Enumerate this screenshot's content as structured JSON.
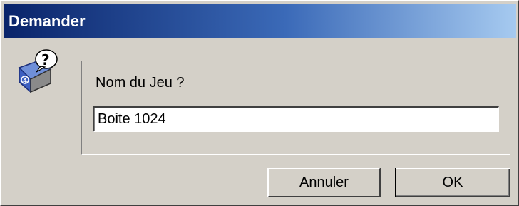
{
  "window": {
    "title": "Demander"
  },
  "icons": {
    "app_icon": "4d-question-icon"
  },
  "prompt": {
    "label": "Nom du Jeu ?",
    "input_value": "Boite 1024"
  },
  "buttons": {
    "cancel_label": "Annuler",
    "ok_label": "OK"
  },
  "colors": {
    "dialog_face": "#d4d0c8",
    "titlebar_start": "#0a246a",
    "titlebar_end": "#a6caf0",
    "title_text": "#ffffff"
  }
}
